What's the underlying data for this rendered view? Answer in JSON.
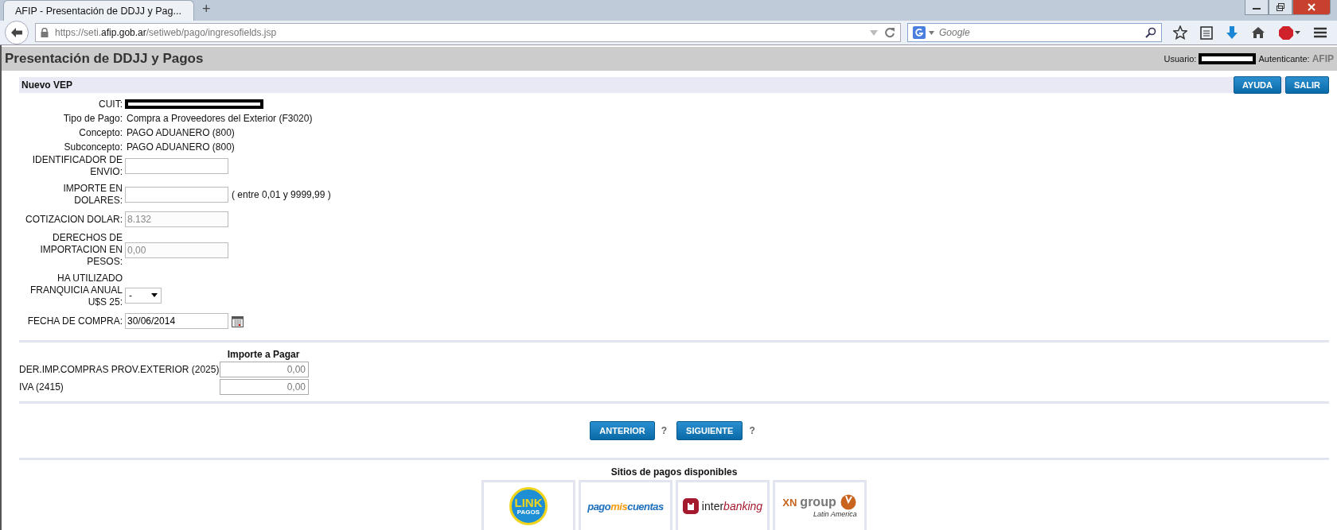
{
  "browser": {
    "tab": {
      "title": "AFIP - Presentación de DDJJ y Pag...",
      "selected": true
    },
    "new_tab": "+",
    "url": "https://seti.**afip.gob.ar**/setiweb/pago/ingresofields.jsp",
    "search": {
      "placeholder": "Google"
    }
  },
  "header": {
    "title": "Presentación de DDJJ y Pagos",
    "user_label": "Usuario:",
    "auth_label": "Autenticante:",
    "auth_value": "AFIP"
  },
  "section": {
    "title": "Nuevo VEP",
    "buttons": [
      "AYUDA",
      "SALIR"
    ]
  },
  "info": [
    {
      "label": "CUIT:",
      "redacted": true
    },
    {
      "label": "Tipo de Pago:",
      "value": "Compra a Proveedores del Exterior (F3020)"
    },
    {
      "label": "Concepto:",
      "value": "PAGO ADUANERO (800)"
    },
    {
      "label": "Subconcepto:",
      "value": "PAGO ADUANERO (800)"
    }
  ],
  "fields": [
    {
      "kind": "input",
      "label": "IDENTIFICADOR DE ENVIO:"
    },
    {
      "kind": "input",
      "label": "IMPORTE EN DOLARES:",
      "hint": "( entre 0,01 y 9999,99 )"
    },
    {
      "kind": "input",
      "label": "COTIZACION DOLAR:",
      "value": "8.132",
      "disabled": true
    },
    {
      "kind": "input",
      "label": "DERECHOS DE IMPORTACION EN PESOS:",
      "value": "0,00",
      "disabled": true
    },
    {
      "kind": "select",
      "label": "HA UTILIZADO FRANQUICIA ANUAL U$S 25:",
      "value": "-"
    },
    {
      "kind": "date",
      "label": "FECHA DE COMPRA:",
      "value": "30/06/2014"
    }
  ],
  "payments": {
    "column": "Importe a Pagar",
    "rows": [
      {
        "label": "DER.IMP.COMPRAS PROV.EXTERIOR (2025)",
        "value": "0,00"
      },
      {
        "label": "IVA (2415)",
        "value": "0,00"
      }
    ]
  },
  "nav": [
    {
      "label": "ANTERIOR",
      "help": "?"
    },
    {
      "label": "SIGUIENTE",
      "help": "?"
    }
  ],
  "sites": {
    "title": "Sitios de pagos disponibles",
    "logos": [
      {
        "kind": "link",
        "text": "LINK",
        "sub": "PAGOS"
      },
      {
        "kind": "pmc",
        "text": "pago",
        "mid": "mis",
        "end": "cuentas"
      },
      {
        "kind": "interbanking",
        "text": "inter",
        "end": "banking"
      },
      {
        "kind": "xn",
        "text": "XN",
        "mid": "group",
        "sub": "Latin America"
      }
    ]
  }
}
